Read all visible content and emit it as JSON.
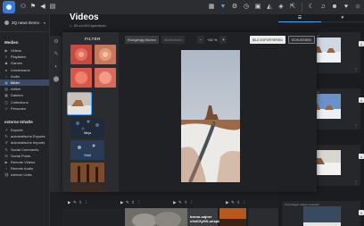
{
  "topbar": {
    "left_icons": [
      "users-icon",
      "flag-icon",
      "megaphone-icon",
      "doc-icon"
    ],
    "right_icons": [
      "grid-icon",
      "funnel-icon",
      "settings-icon",
      "clock-icon",
      "calendar-icon",
      "bell-icon",
      "tag-icon",
      "external-icon"
    ],
    "far_right_icons": [
      "moon-icon",
      "bell-icon",
      "user-icon",
      "heart-icon",
      "user-icon"
    ]
  },
  "sidebar": {
    "workspace": "3Q news Demo",
    "section1": "Medien",
    "items": [
      {
        "label": "Videos",
        "icon": "▶"
      },
      {
        "label": "Playlisten",
        "icon": "≡"
      },
      {
        "label": "Games",
        "icon": "◆"
      },
      {
        "label": "Livestreams",
        "icon": "●"
      },
      {
        "label": "Audio",
        "icon": "♪"
      },
      {
        "label": "Bilder",
        "icon": "▣"
      },
      {
        "label": "Artikel",
        "icon": "▤"
      },
      {
        "label": "Dateien",
        "icon": "▦"
      },
      {
        "label": "Collections",
        "icon": "◫"
      },
      {
        "label": "Personen",
        "icon": "☺"
      }
    ],
    "section2": "externe Inhalte",
    "items2": [
      {
        "label": "Exporte",
        "icon": "↗"
      },
      {
        "label": "automatische Exports",
        "icon": "↻"
      },
      {
        "label": "automatische Imports",
        "icon": "↺"
      },
      {
        "label": "Social Comments",
        "icon": "✎"
      },
      {
        "label": "Social Posts",
        "icon": "✉"
      },
      {
        "label": "Remote Videos",
        "icon": "▶"
      },
      {
        "label": "Remote Audio",
        "icon": "♪"
      },
      {
        "label": "externe Links",
        "icon": "⛓"
      }
    ]
  },
  "strip_icons": [
    "⚙",
    "✎",
    "◐",
    "⬤"
  ],
  "page": {
    "title": "Videos",
    "subtitle": "1 - 55 von 55 Ergebnissen"
  },
  "modal": {
    "filter_title": "FILTER",
    "toolbar": {
      "undo": "Rückgängig Machen",
      "redo": "Wiederholen",
      "zoom_value": "+62 %",
      "export": "BILD EXPORTIEREN",
      "close": "SCHLIESSEN"
    },
    "filter_labels": [
      "Ninja",
      "Gold",
      "Ruby",
      "Mauve"
    ]
  },
  "right_panel": {
    "tabs": [
      "☰",
      "♥"
    ],
    "cards": [
      {
        "caption": "Kutzi Dagan videos unsplash"
      },
      {
        "caption": "Kutzi Dagan videos unsplash"
      },
      {
        "caption": "Sigi Sprüch von Renner"
      },
      {
        "caption": "Kutzi Dagan videos unsplash"
      }
    ]
  },
  "background_card_text": [
    "bruno-sajner",
    "xXcKXyG0-unsplash"
  ]
}
